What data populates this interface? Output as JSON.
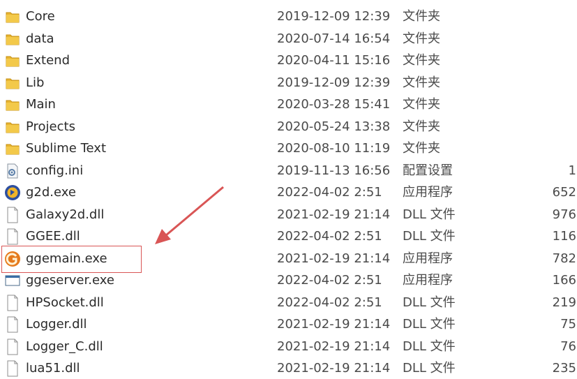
{
  "files": [
    {
      "name": "Core",
      "date": "2019-12-09 12:39",
      "type": "文件夹",
      "size": "",
      "icon": "folder-icon"
    },
    {
      "name": "data",
      "date": "2020-07-14 16:54",
      "type": "文件夹",
      "size": "",
      "icon": "folder-icon"
    },
    {
      "name": "Extend",
      "date": "2020-04-11 15:16",
      "type": "文件夹",
      "size": "",
      "icon": "folder-icon"
    },
    {
      "name": "Lib",
      "date": "2019-12-09 12:39",
      "type": "文件夹",
      "size": "",
      "icon": "folder-icon"
    },
    {
      "name": "Main",
      "date": "2020-03-28 15:41",
      "type": "文件夹",
      "size": "",
      "icon": "folder-icon"
    },
    {
      "name": "Projects",
      "date": "2020-05-24 13:38",
      "type": "文件夹",
      "size": "",
      "icon": "folder-icon"
    },
    {
      "name": "Sublime Text",
      "date": "2020-08-10 11:19",
      "type": "文件夹",
      "size": "",
      "icon": "folder-icon"
    },
    {
      "name": "config.ini",
      "date": "2019-11-13 16:56",
      "type": "配置设置",
      "size": "1",
      "icon": "settings-file-icon"
    },
    {
      "name": "g2d.exe",
      "date": "2022-04-02 2:51",
      "type": "应用程序",
      "size": "652",
      "icon": "g2d-app-icon"
    },
    {
      "name": "Galaxy2d.dll",
      "date": "2021-02-19 21:14",
      "type": "DLL 文件",
      "size": "976",
      "icon": "document-icon"
    },
    {
      "name": "GGEE.dll",
      "date": "2022-04-02 2:51",
      "type": "DLL 文件",
      "size": "116",
      "icon": "document-icon"
    },
    {
      "name": "ggemain.exe",
      "date": "2021-02-19 21:14",
      "type": "应用程序",
      "size": "782",
      "icon": "gge-app-icon"
    },
    {
      "name": "ggeserver.exe",
      "date": "2022-04-02 2:51",
      "type": "应用程序",
      "size": "166",
      "icon": "window-app-icon"
    },
    {
      "name": "HPSocket.dll",
      "date": "2022-04-02 2:51",
      "type": "DLL 文件",
      "size": "219",
      "icon": "document-icon"
    },
    {
      "name": "Logger.dll",
      "date": "2021-02-19 21:14",
      "type": "DLL 文件",
      "size": "75",
      "icon": "document-icon"
    },
    {
      "name": "Logger_C.dll",
      "date": "2021-02-19 21:14",
      "type": "DLL 文件",
      "size": "76",
      "icon": "document-icon"
    },
    {
      "name": "lua51.dll",
      "date": "2021-02-19 21:14",
      "type": "DLL 文件",
      "size": "235",
      "icon": "document-icon"
    }
  ],
  "colors": {
    "annotation": "#d95555",
    "folder": "#e8b531"
  }
}
